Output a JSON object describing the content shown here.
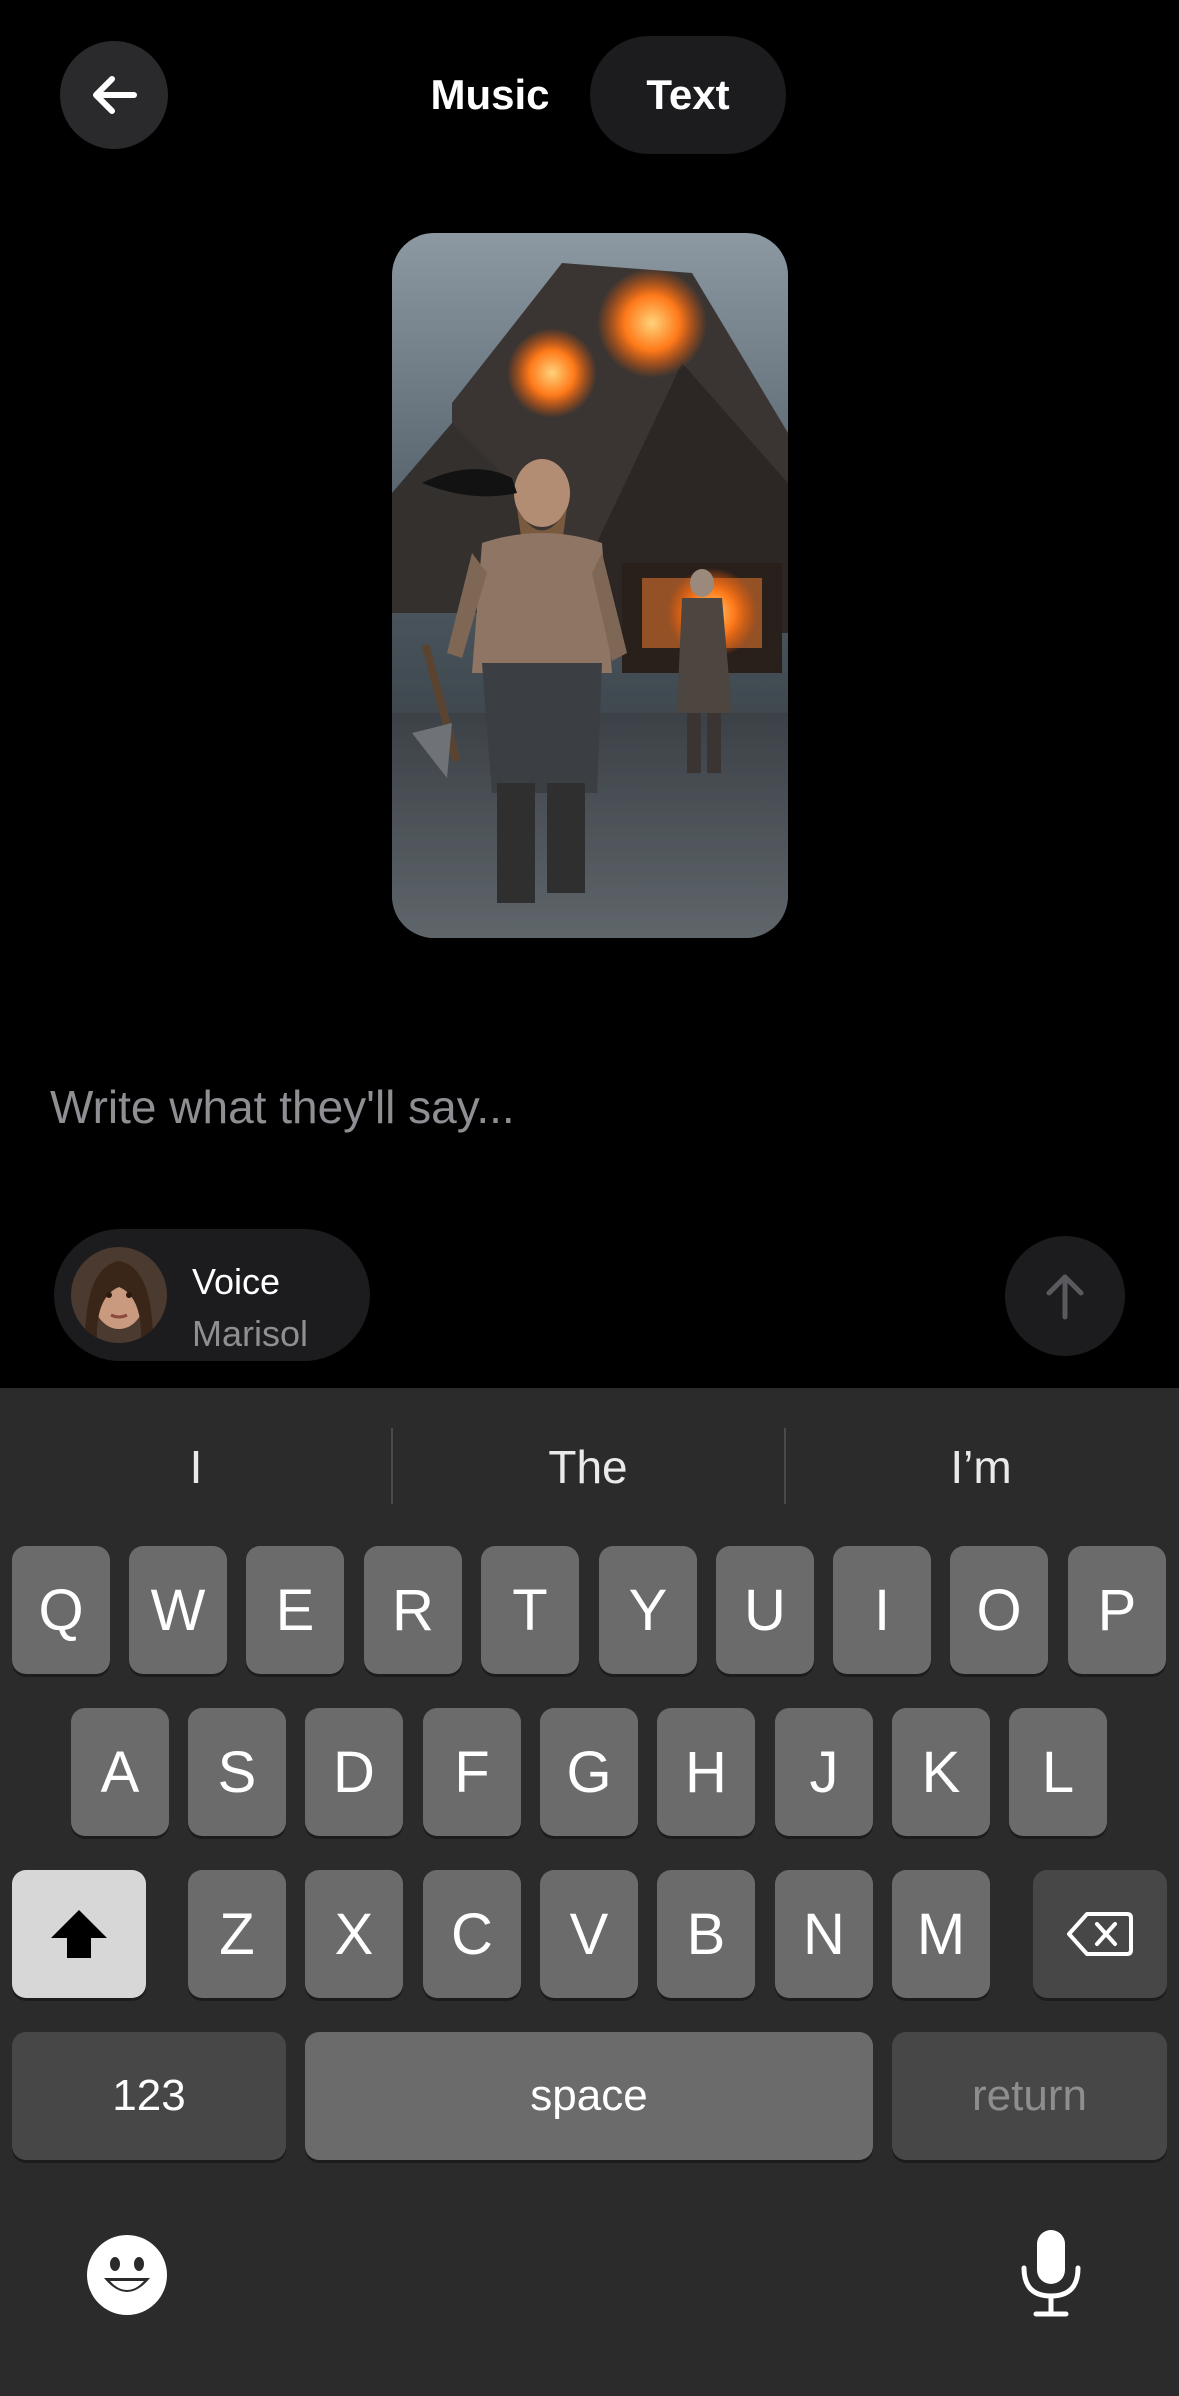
{
  "header": {
    "back_icon": "arrow-left-icon",
    "tabs": [
      {
        "label": "Music",
        "selected": false
      },
      {
        "label": "Text",
        "selected": true
      }
    ]
  },
  "preview": {
    "image_icon": "viking-warrior-image"
  },
  "composer": {
    "placeholder": "Write what they'll say...",
    "voice_label": "Voice",
    "voice_name": "Marisol",
    "send_icon": "arrow-up-icon"
  },
  "keyboard": {
    "suggestions": [
      "I",
      "The",
      "I’m"
    ],
    "row1": [
      "Q",
      "W",
      "E",
      "R",
      "T",
      "Y",
      "U",
      "I",
      "O",
      "P"
    ],
    "row2": [
      "A",
      "S",
      "D",
      "F",
      "G",
      "H",
      "J",
      "K",
      "L"
    ],
    "row3": [
      "Z",
      "X",
      "C",
      "V",
      "B",
      "N",
      "M"
    ],
    "numbers_label": "123",
    "space_label": "space",
    "return_label": "return",
    "shift_icon": "shift-icon",
    "delete_icon": "delete-icon",
    "emoji_icon": "emoji-icon",
    "mic_icon": "microphone-icon"
  }
}
